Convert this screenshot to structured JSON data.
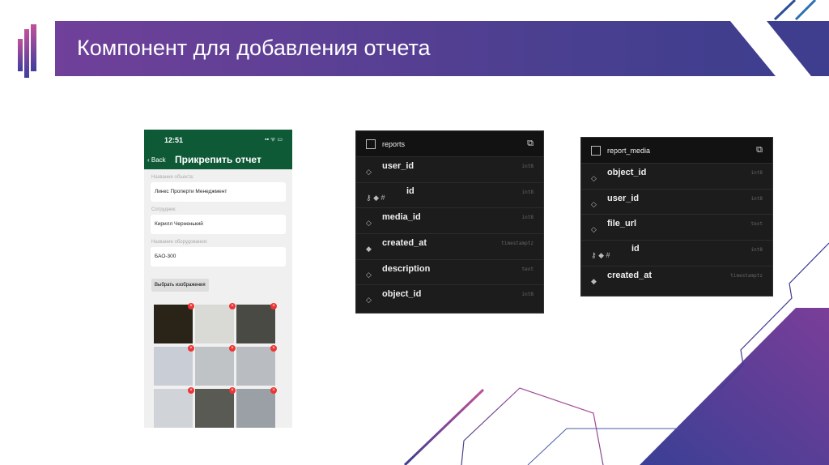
{
  "slide": {
    "title": "Компонент для добавления отчета"
  },
  "phone": {
    "time": "12:51",
    "status": "▪▪ ᯤ ▭",
    "back": "‹ Back",
    "title": "Прикрепить отчет",
    "fields": [
      {
        "label": "Название объекта:",
        "value": "Линкс Проперти Менеджмент"
      },
      {
        "label": "Сотрудник:",
        "value": "Кирилл Черненький"
      },
      {
        "label": "Название оборудования:",
        "value": "БАО-300"
      }
    ],
    "pick_button": "Выбрать изображения",
    "remove_glyph": "×",
    "photo_colors": [
      "#2a2418",
      "#d9d9d6",
      "#4a4a44",
      "#c9cdd6",
      "#bfc3c6",
      "#b9bcc0",
      "#d0d3d8",
      "#5a5a55",
      "#9aa0a6"
    ]
  },
  "tables": [
    {
      "name": "reports",
      "open_icon": "⧉",
      "columns": [
        {
          "name": "user_id",
          "type": "int8",
          "key": false,
          "filled": false
        },
        {
          "name": "id",
          "type": "int8",
          "key": true,
          "filled": true
        },
        {
          "name": "media_id",
          "type": "int8",
          "key": false,
          "filled": false
        },
        {
          "name": "created_at",
          "type": "timestamptz",
          "key": false,
          "filled": true
        },
        {
          "name": "description",
          "type": "text",
          "key": false,
          "filled": false
        },
        {
          "name": "object_id",
          "type": "int8",
          "key": false,
          "filled": false
        }
      ]
    },
    {
      "name": "report_media",
      "open_icon": "⧉",
      "columns": [
        {
          "name": "object_id",
          "type": "int8",
          "key": false,
          "filled": false
        },
        {
          "name": "user_id",
          "type": "int8",
          "key": false,
          "filled": false
        },
        {
          "name": "file_url",
          "type": "text",
          "key": false,
          "filled": false
        },
        {
          "name": "id",
          "type": "int8",
          "key": true,
          "filled": true
        },
        {
          "name": "created_at",
          "type": "timestamptz",
          "key": false,
          "filled": true
        }
      ]
    }
  ],
  "colors": {
    "accent": "#6f3f96",
    "blue": "#3f3e8e",
    "phone_header": "#0e5a36"
  }
}
